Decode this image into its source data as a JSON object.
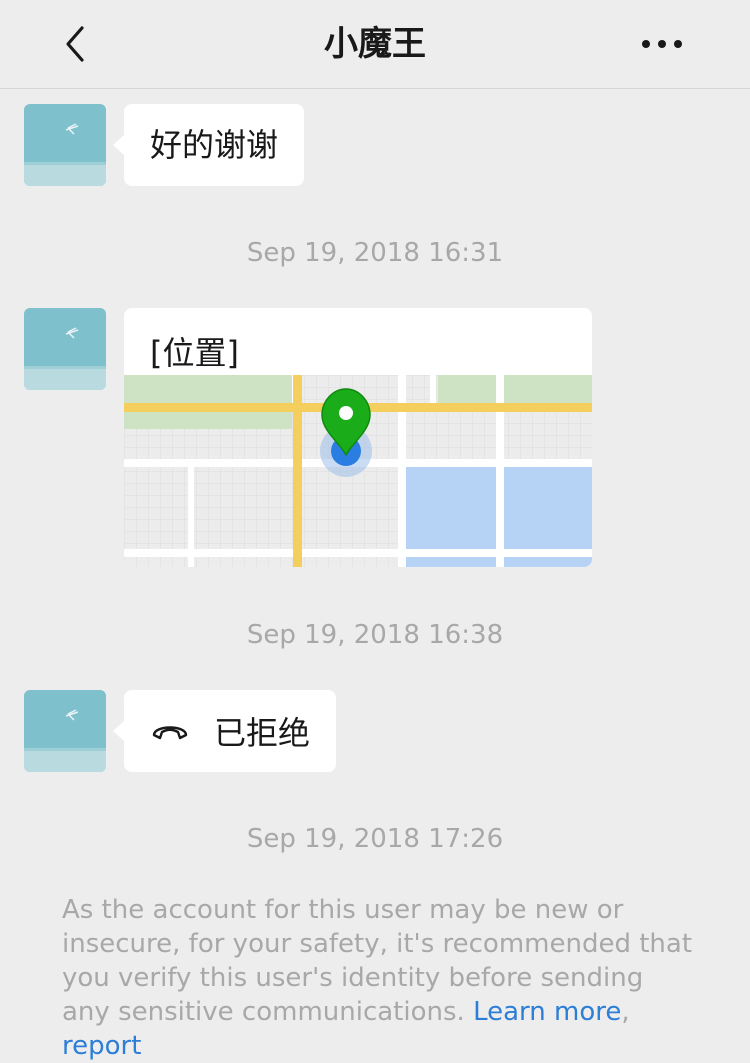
{
  "header": {
    "title": "小魔王"
  },
  "messages": [
    {
      "type": "text",
      "text": "好的谢谢"
    },
    {
      "type": "timestamp",
      "text": "Sep 19, 2018 16:31"
    },
    {
      "type": "location",
      "label": "[位置]"
    },
    {
      "type": "timestamp",
      "text": "Sep 19, 2018 16:38"
    },
    {
      "type": "call",
      "text": "已拒绝"
    },
    {
      "type": "timestamp",
      "text": "Sep 19, 2018 17:26"
    }
  ],
  "notice": {
    "text": "As the account for this user may be new or insecure, for your safety, it's recommended that you verify this user's identity before sending any sensitive communications.",
    "learn_more": "Learn more",
    "separator": ",",
    "report": "report"
  },
  "colors": {
    "background": "#ededed",
    "bubble": "#ffffff",
    "link": "#2c7ed6",
    "pin": "#1aad19",
    "map_road": "#f5cf5e",
    "map_block": "#b6d3f6"
  }
}
